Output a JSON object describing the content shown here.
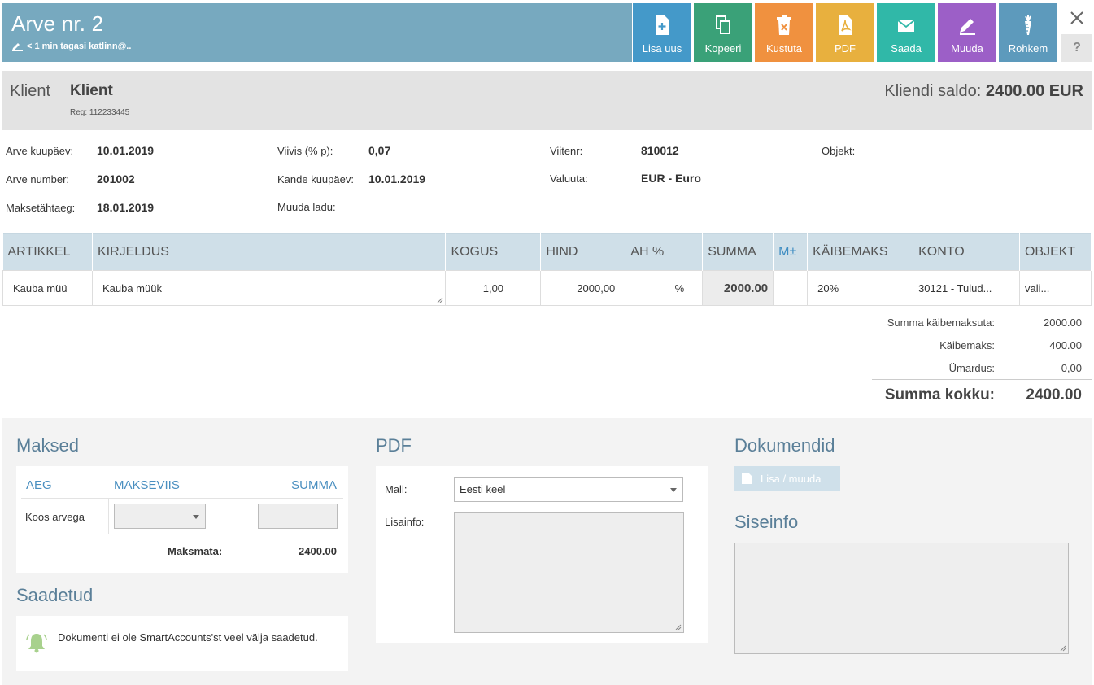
{
  "header": {
    "title": "Arve nr. 2",
    "subtitle": "< 1 min tagasi katlinn@.."
  },
  "toolbar": [
    {
      "label": "Lisa uus",
      "icon": "add-document-icon",
      "color": "#4499c9"
    },
    {
      "label": "Kopeeri",
      "icon": "copy-icon",
      "color": "#3aa178"
    },
    {
      "label": "Kustuta",
      "icon": "trash-icon",
      "color": "#f0913f"
    },
    {
      "label": "PDF",
      "icon": "pdf-icon",
      "color": "#e8b03e"
    },
    {
      "label": "Saada",
      "icon": "envelope-icon",
      "color": "#30b8a8"
    },
    {
      "label": "Muuda",
      "icon": "pencil-icon",
      "color": "#9c5fc7"
    },
    {
      "label": "Rohkem",
      "icon": "carrot-icon",
      "color": "#5d9abc"
    }
  ],
  "help_label": "?",
  "client": {
    "label": "Klient",
    "name": "Klient",
    "reg": "Reg: 112233445",
    "saldo_label": "Kliendi saldo:",
    "saldo_value": "2400.00 EUR"
  },
  "info": {
    "invoice_date_label": "Arve kuupäev:",
    "invoice_date": "10.01.2019",
    "invoice_number_label": "Arve number:",
    "invoice_number": "201002",
    "due_date_label": "Maksetähtaeg:",
    "due_date": "18.01.2019",
    "penalty_label": "Viivis (% p):",
    "penalty": "0,07",
    "entry_date_label": "Kande kuupäev:",
    "entry_date": "10.01.2019",
    "warehouse_label": "Muuda ladu:",
    "reference_label": "Viitenr:",
    "reference": "810012",
    "currency_label": "Valuuta:",
    "currency": "EUR - Euro",
    "object_label": "Objekt:"
  },
  "items": {
    "headers": [
      "ARTIKKEL",
      "KIRJELDUS",
      "KOGUS",
      "HIND",
      "AH %",
      "SUMMA",
      "M±",
      "KÄIBEMAKS",
      "KONTO",
      "OBJEKT"
    ],
    "rows": [
      {
        "article": "Kauba müü",
        "description": "Kauba müük",
        "quantity": "1,00",
        "price": "2000,00",
        "discount": "%",
        "sum": "2000.00",
        "mpm": "",
        "vat": "20%",
        "account": "30121 - Tulud...",
        "object": "vali..."
      }
    ]
  },
  "totals": {
    "net_label": "Summa käibemaksuta:",
    "net": "2000.00",
    "vat_label": "Käibemaks:",
    "vat": "400.00",
    "rounding_label": "Ümardus:",
    "rounding": "0,00",
    "grand_label": "Summa kokku:",
    "grand": "2400.00"
  },
  "payments": {
    "title": "Maksed",
    "col_time": "AEG",
    "col_method": "MAKSEVIIS",
    "col_sum": "SUMMA",
    "row_label": "Koos arvega",
    "unpaid_label": "Maksmata:",
    "unpaid": "2400.00"
  },
  "sent": {
    "title": "Saadetud",
    "message": "Dokumenti ei ole SmartAccounts'st veel välja saadetud."
  },
  "pdf": {
    "title": "PDF",
    "template_label": "Mall:",
    "template_value": "Eesti keel",
    "extra_label": "Lisainfo:"
  },
  "documents": {
    "title": "Dokumendid",
    "button": "Lisa / muuda"
  },
  "internal": {
    "title": "Siseinfo"
  }
}
